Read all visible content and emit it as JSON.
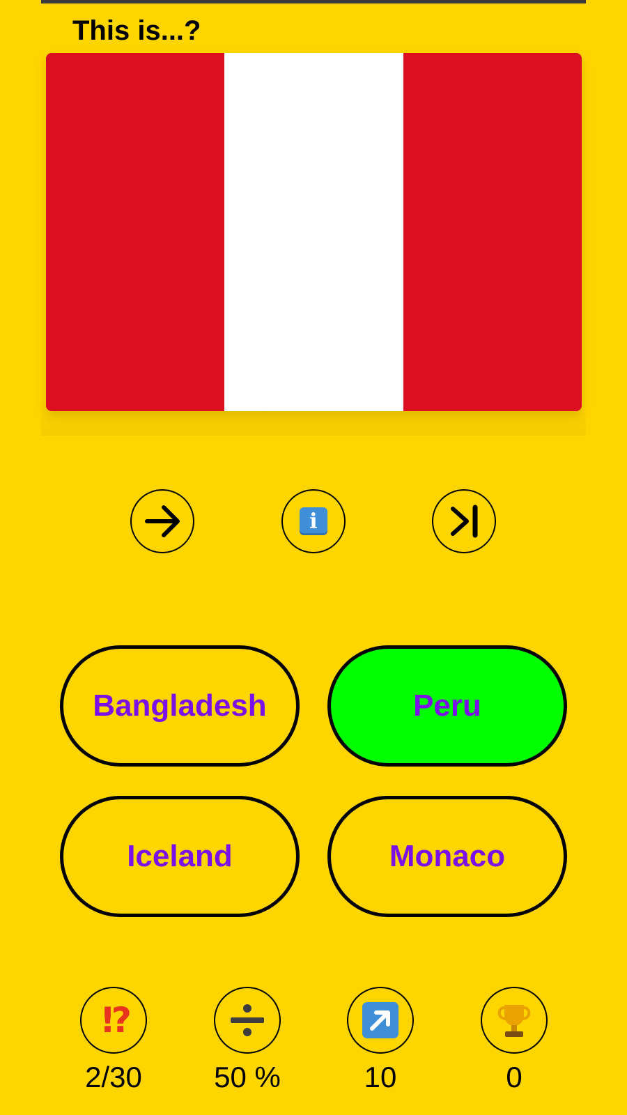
{
  "question": "This is...?",
  "flag": {
    "stripes": [
      "#DA1021",
      "#FFFFFF",
      "#DA1021"
    ]
  },
  "controls": [
    {
      "id": "next",
      "icon": "arrow-right-icon"
    },
    {
      "id": "info",
      "icon": "info-icon",
      "glyph": "i"
    },
    {
      "id": "skip",
      "icon": "skip-to-end-icon"
    }
  ],
  "answers": [
    {
      "label": "Bangladesh",
      "state": "default"
    },
    {
      "label": "Peru",
      "state": "correct"
    },
    {
      "label": "Iceland",
      "state": "default"
    },
    {
      "label": "Monaco",
      "state": "default"
    }
  ],
  "colors": {
    "background": "#FFD500",
    "answer_text": "#7A12E8",
    "correct": "#00FF00"
  },
  "stats": [
    {
      "icon": "exclamation-question-icon",
      "value": "2/30"
    },
    {
      "icon": "division-icon",
      "value": "50 %"
    },
    {
      "icon": "up-right-arrow-icon",
      "value": "10"
    },
    {
      "icon": "trophy-icon",
      "value": "0"
    }
  ]
}
